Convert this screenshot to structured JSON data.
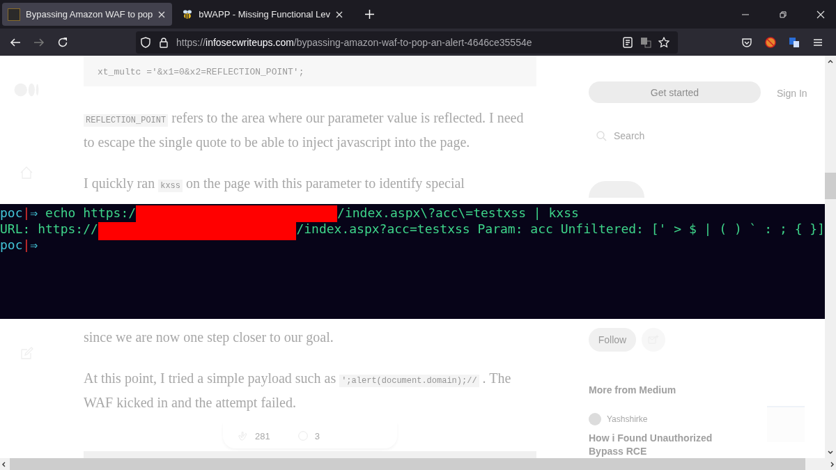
{
  "browser": {
    "tabs": [
      {
        "title": "Bypassing Amazon WAF to pop",
        "selected": true,
        "kind": "site"
      },
      {
        "title": "bWAPP - Missing Functional Lev",
        "selected": false,
        "kind": "bee"
      }
    ],
    "nav": {
      "back_disabled": false,
      "forward_disabled": true
    },
    "url": {
      "scheme": "https://",
      "host": "infosecwriteups.com",
      "path": "/bypassing-amazon-waf-to-pop-an-alert-4646ce35554e"
    }
  },
  "article": {
    "code_line": "xt_multc ='&x1=0&x2=REFLECTION_POINT';",
    "paragraphs": [
      {
        "runs": [
          {
            "kind": "code",
            "text": "REFLECTION_POINT"
          },
          {
            "kind": "text",
            "text": " refers to the area where our parameter value is reflected. I need to escape the single quote to be able to inject javascript into the page."
          }
        ]
      },
      {
        "runs": [
          {
            "kind": "text",
            "text": "I quickly ran "
          },
          {
            "kind": "code",
            "text": "kxss"
          },
          {
            "kind": "text",
            "text": " on the page with this parameter to identify special"
          }
        ]
      },
      {
        "runs": [
          {
            "kind": "text",
            "text": "since we are now one step closer to our goal."
          }
        ]
      },
      {
        "runs": [
          {
            "kind": "text",
            "text": "At this point, I tried a simple payload such as "
          },
          {
            "kind": "code",
            "text": "';alert(document.domain);//"
          },
          {
            "kind": "text",
            "text": " . The WAF kicked in and the attempt failed."
          }
        ]
      }
    ],
    "claps": "281",
    "comments": "3"
  },
  "sidebar": {
    "get_started": "Get started",
    "sign_in": "Sign In",
    "search": {
      "placeholder": "Search"
    },
    "follow": "Follow",
    "more_heading": "More from Medium",
    "story": {
      "author": "Yashshirke",
      "title": "How i Found Unauthorized Bypass RCE"
    }
  },
  "terminal": {
    "lines": [
      {
        "segments": [
          {
            "kind": "prompt",
            "text": "poc"
          },
          {
            "kind": "sep",
            "text": "|"
          },
          {
            "kind": "arrow",
            "text": "⇒"
          },
          {
            "kind": "text",
            "text": " echo https:/"
          },
          {
            "kind": "redacted"
          },
          {
            "kind": "text",
            "text": "/index.aspx\\?acc\\=testxss | kxss"
          }
        ]
      },
      {
        "segments": [
          {
            "kind": "text",
            "text": "URL: https://"
          },
          {
            "kind": "redacted"
          },
          {
            "kind": "text",
            "text": "/index.aspx?acc=testxss Param: acc Unfiltered: [' > $ | ( ) ` : ; { }]"
          }
        ]
      },
      {
        "segments": [
          {
            "kind": "prompt",
            "text": "poc"
          },
          {
            "kind": "sep",
            "text": "|"
          },
          {
            "kind": "arrow",
            "text": "⇒"
          }
        ]
      }
    ]
  }
}
